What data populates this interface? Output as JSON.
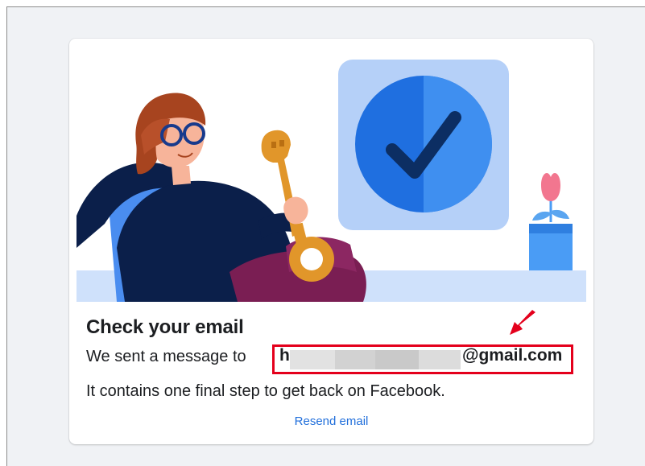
{
  "card": {
    "title": "Check your email",
    "message_prefix": "We sent a message to",
    "email_visible_start": "h",
    "email_domain": "@gmail.com",
    "message_detail": "It contains one final step to get back on Facebook.",
    "resend_label": "Resend email"
  },
  "annotation": {
    "highlight_color": "#e4001c",
    "arrow_icon": "red-arrow-icon"
  },
  "colors": {
    "page_bg": "#f0f2f5",
    "link": "#216fdb",
    "text": "#1c1e21"
  }
}
